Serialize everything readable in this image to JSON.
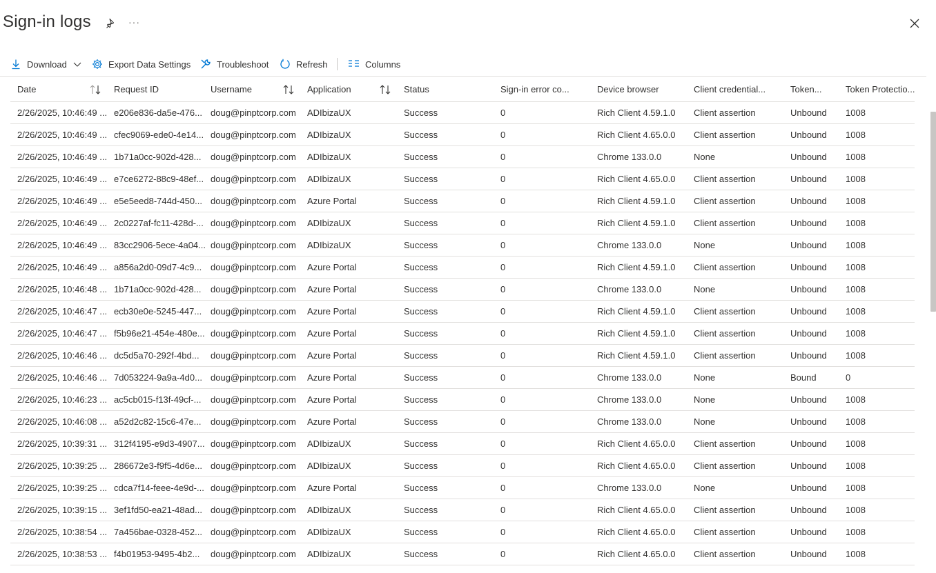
{
  "header": {
    "title": "Sign-in logs",
    "more": "···"
  },
  "toolbar": {
    "download": "Download",
    "export": "Export Data Settings",
    "troubleshoot": "Troubleshoot",
    "refresh": "Refresh",
    "columns": "Columns"
  },
  "table": {
    "columns": {
      "date": "Date",
      "request_id": "Request ID",
      "username": "Username",
      "application": "Application",
      "status": "Status",
      "error_code": "Sign-in error co...",
      "device_browser": "Device browser",
      "client_credential": "Client credential...",
      "token": "Token...",
      "token_protection": "Token Protectio..."
    },
    "rows": [
      {
        "date": "2/26/2025, 10:46:49 ...",
        "request_id": "e206e836-da5e-476...",
        "username": "doug@pinptcorp.com",
        "application": "ADIbizaUX",
        "status": "Success",
        "error_code": "0",
        "device_browser": "Rich Client 4.59.1.0",
        "client_credential": "Client assertion",
        "token": "Unbound",
        "token_protection": "1008"
      },
      {
        "date": "2/26/2025, 10:46:49 ...",
        "request_id": "cfec9069-ede0-4e14...",
        "username": "doug@pinptcorp.com",
        "application": "ADIbizaUX",
        "status": "Success",
        "error_code": "0",
        "device_browser": "Rich Client 4.65.0.0",
        "client_credential": "Client assertion",
        "token": "Unbound",
        "token_protection": "1008"
      },
      {
        "date": "2/26/2025, 10:46:49 ...",
        "request_id": "1b71a0cc-902d-428...",
        "username": "doug@pinptcorp.com",
        "application": "ADIbizaUX",
        "status": "Success",
        "error_code": "0",
        "device_browser": "Chrome 133.0.0",
        "client_credential": "None",
        "token": "Unbound",
        "token_protection": "1008"
      },
      {
        "date": "2/26/2025, 10:46:49 ...",
        "request_id": "e7ce6272-88c9-48ef...",
        "username": "doug@pinptcorp.com",
        "application": "ADIbizaUX",
        "status": "Success",
        "error_code": "0",
        "device_browser": "Rich Client 4.65.0.0",
        "client_credential": "Client assertion",
        "token": "Unbound",
        "token_protection": "1008"
      },
      {
        "date": "2/26/2025, 10:46:49 ...",
        "request_id": "e5e5eed8-744d-450...",
        "username": "doug@pinptcorp.com",
        "application": "Azure Portal",
        "status": "Success",
        "error_code": "0",
        "device_browser": "Rich Client 4.59.1.0",
        "client_credential": "Client assertion",
        "token": "Unbound",
        "token_protection": "1008"
      },
      {
        "date": "2/26/2025, 10:46:49 ...",
        "request_id": "2c0227af-fc11-428d-...",
        "username": "doug@pinptcorp.com",
        "application": "ADIbizaUX",
        "status": "Success",
        "error_code": "0",
        "device_browser": "Rich Client 4.59.1.0",
        "client_credential": "Client assertion",
        "token": "Unbound",
        "token_protection": "1008"
      },
      {
        "date": "2/26/2025, 10:46:49 ...",
        "request_id": "83cc2906-5ece-4a04...",
        "username": "doug@pinptcorp.com",
        "application": "ADIbizaUX",
        "status": "Success",
        "error_code": "0",
        "device_browser": "Chrome 133.0.0",
        "client_credential": "None",
        "token": "Unbound",
        "token_protection": "1008"
      },
      {
        "date": "2/26/2025, 10:46:49 ...",
        "request_id": "a856a2d0-09d7-4c9...",
        "username": "doug@pinptcorp.com",
        "application": "Azure Portal",
        "status": "Success",
        "error_code": "0",
        "device_browser": "Rich Client 4.59.1.0",
        "client_credential": "Client assertion",
        "token": "Unbound",
        "token_protection": "1008"
      },
      {
        "date": "2/26/2025, 10:46:48 ...",
        "request_id": "1b71a0cc-902d-428...",
        "username": "doug@pinptcorp.com",
        "application": "Azure Portal",
        "status": "Success",
        "error_code": "0",
        "device_browser": "Chrome 133.0.0",
        "client_credential": "None",
        "token": "Unbound",
        "token_protection": "1008"
      },
      {
        "date": "2/26/2025, 10:46:47 ...",
        "request_id": "ecb30e0e-5245-447...",
        "username": "doug@pinptcorp.com",
        "application": "Azure Portal",
        "status": "Success",
        "error_code": "0",
        "device_browser": "Rich Client 4.59.1.0",
        "client_credential": "Client assertion",
        "token": "Unbound",
        "token_protection": "1008"
      },
      {
        "date": "2/26/2025, 10:46:47 ...",
        "request_id": "f5b96e21-454e-480e...",
        "username": "doug@pinptcorp.com",
        "application": "Azure Portal",
        "status": "Success",
        "error_code": "0",
        "device_browser": "Rich Client 4.59.1.0",
        "client_credential": "Client assertion",
        "token": "Unbound",
        "token_protection": "1008"
      },
      {
        "date": "2/26/2025, 10:46:46 ...",
        "request_id": "dc5d5a70-292f-4bd...",
        "username": "doug@pinptcorp.com",
        "application": "Azure Portal",
        "status": "Success",
        "error_code": "0",
        "device_browser": "Rich Client 4.59.1.0",
        "client_credential": "Client assertion",
        "token": "Unbound",
        "token_protection": "1008"
      },
      {
        "date": "2/26/2025, 10:46:46 ...",
        "request_id": "7d053224-9a9a-4d0...",
        "username": "doug@pinptcorp.com",
        "application": "Azure Portal",
        "status": "Success",
        "error_code": "0",
        "device_browser": "Chrome 133.0.0",
        "client_credential": "None",
        "token": "Bound",
        "token_protection": "0"
      },
      {
        "date": "2/26/2025, 10:46:23 ...",
        "request_id": "ac5cb015-f13f-49cf-...",
        "username": "doug@pinptcorp.com",
        "application": "Azure Portal",
        "status": "Success",
        "error_code": "0",
        "device_browser": "Chrome 133.0.0",
        "client_credential": "None",
        "token": "Unbound",
        "token_protection": "1008"
      },
      {
        "date": "2/26/2025, 10:46:08 ...",
        "request_id": "a52d2c82-15c6-47e...",
        "username": "doug@pinptcorp.com",
        "application": "Azure Portal",
        "status": "Success",
        "error_code": "0",
        "device_browser": "Chrome 133.0.0",
        "client_credential": "None",
        "token": "Unbound",
        "token_protection": "1008"
      },
      {
        "date": "2/26/2025, 10:39:31 ...",
        "request_id": "312f4195-e9d3-4907...",
        "username": "doug@pinptcorp.com",
        "application": "ADIbizaUX",
        "status": "Success",
        "error_code": "0",
        "device_browser": "Rich Client 4.65.0.0",
        "client_credential": "Client assertion",
        "token": "Unbound",
        "token_protection": "1008"
      },
      {
        "date": "2/26/2025, 10:39:25 ...",
        "request_id": "286672e3-f9f5-4d6e...",
        "username": "doug@pinptcorp.com",
        "application": "ADIbizaUX",
        "status": "Success",
        "error_code": "0",
        "device_browser": "Rich Client 4.65.0.0",
        "client_credential": "Client assertion",
        "token": "Unbound",
        "token_protection": "1008"
      },
      {
        "date": "2/26/2025, 10:39:25 ...",
        "request_id": "cdca7f14-feee-4e9d-...",
        "username": "doug@pinptcorp.com",
        "application": "Azure Portal",
        "status": "Success",
        "error_code": "0",
        "device_browser": "Chrome 133.0.0",
        "client_credential": "None",
        "token": "Unbound",
        "token_protection": "1008"
      },
      {
        "date": "2/26/2025, 10:39:15 ...",
        "request_id": "3ef1fd50-ea21-48ad...",
        "username": "doug@pinptcorp.com",
        "application": "ADIbizaUX",
        "status": "Success",
        "error_code": "0",
        "device_browser": "Rich Client 4.65.0.0",
        "client_credential": "Client assertion",
        "token": "Unbound",
        "token_protection": "1008"
      },
      {
        "date": "2/26/2025, 10:38:54 ...",
        "request_id": "7a456bae-0328-452...",
        "username": "doug@pinptcorp.com",
        "application": "ADIbizaUX",
        "status": "Success",
        "error_code": "0",
        "device_browser": "Rich Client 4.65.0.0",
        "client_credential": "Client assertion",
        "token": "Unbound",
        "token_protection": "1008"
      },
      {
        "date": "2/26/2025, 10:38:53 ...",
        "request_id": "f4b01953-9495-4b2...",
        "username": "doug@pinptcorp.com",
        "application": "ADIbizaUX",
        "status": "Success",
        "error_code": "0",
        "device_browser": "Rich Client 4.65.0.0",
        "client_credential": "Client assertion",
        "token": "Unbound",
        "token_protection": "1008"
      }
    ]
  },
  "colors": {
    "accent": "#0078d4",
    "text": "#323130",
    "border": "#e1dfdd",
    "scrollbar": "#c8c6c4"
  },
  "icons": {
    "pin": "pin-icon",
    "more": "more-icon",
    "close": "close-icon",
    "download": "download-icon",
    "chevron": "chevron-down-icon",
    "export": "gear-icon",
    "troubleshoot": "wrench-icon",
    "refresh": "refresh-icon",
    "columns": "columns-icon",
    "sort": "sort-icon"
  }
}
